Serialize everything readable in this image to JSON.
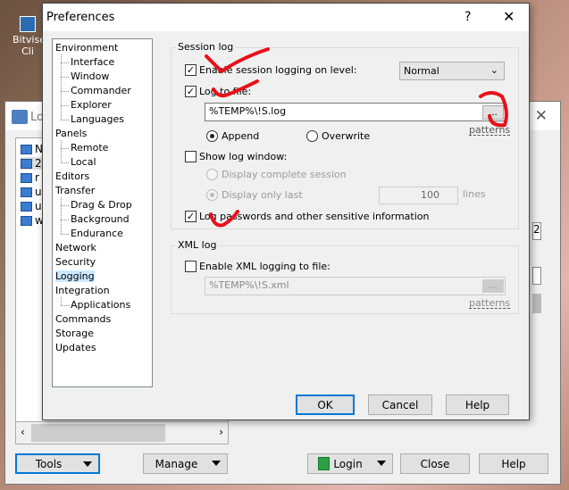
{
  "desktop": {
    "icon_label": "Bitvise Cli"
  },
  "login_window": {
    "title": "Lo",
    "sites": [
      "N",
      "2",
      "r",
      "u",
      "u",
      "w"
    ],
    "value_right": "2",
    "buttons": {
      "tools": "Tools",
      "manage": "Manage",
      "login": "Login",
      "close": "Close",
      "help": "Help"
    }
  },
  "prefs": {
    "title": "Preferences",
    "help_q": "?",
    "close": "✕",
    "tree": [
      {
        "label": "Environment",
        "level": 0
      },
      {
        "label": "Interface",
        "level": 1
      },
      {
        "label": "Window",
        "level": 1
      },
      {
        "label": "Commander",
        "level": 1
      },
      {
        "label": "Explorer",
        "level": 1
      },
      {
        "label": "Languages",
        "level": 1
      },
      {
        "label": "Panels",
        "level": 0
      },
      {
        "label": "Remote",
        "level": 1
      },
      {
        "label": "Local",
        "level": 1
      },
      {
        "label": "Editors",
        "level": 0
      },
      {
        "label": "Transfer",
        "level": 0
      },
      {
        "label": "Drag & Drop",
        "level": 1
      },
      {
        "label": "Background",
        "level": 1
      },
      {
        "label": "Endurance",
        "level": 1
      },
      {
        "label": "Network",
        "level": 0
      },
      {
        "label": "Security",
        "level": 0
      },
      {
        "label": "Logging",
        "level": 0,
        "selected": true
      },
      {
        "label": "Integration",
        "level": 0
      },
      {
        "label": "Applications",
        "level": 1
      },
      {
        "label": "Commands",
        "level": 0
      },
      {
        "label": "Storage",
        "level": 0
      },
      {
        "label": "Updates",
        "level": 0
      }
    ],
    "session_log": {
      "title": "Session log",
      "enable_label": "Enable session logging on level:",
      "enable_checked": true,
      "level": "Normal",
      "log_to_file_label": "Log to file:",
      "log_to_file_checked": true,
      "file": "%TEMP%\\!S.log",
      "browse": "...",
      "patterns": "patterns",
      "append": "Append",
      "overwrite": "Overwrite",
      "mode": "append",
      "show_window_label": "Show log window:",
      "show_window_checked": false,
      "display_complete": "Display complete session",
      "display_last": "Display only last",
      "lines_value": "100",
      "lines_label": "lines",
      "log_passwords_label": "Log passwords and other sensitive information",
      "log_passwords_checked": true
    },
    "xml_log": {
      "title": "XML log",
      "enable_label": "Enable XML logging to file:",
      "enable_checked": false,
      "file": "%TEMP%\\!S.xml",
      "browse": "...",
      "patterns": "patterns"
    },
    "buttons": {
      "ok": "OK",
      "cancel": "Cancel",
      "help": "Help"
    }
  },
  "annotation_color": "#e8101a"
}
